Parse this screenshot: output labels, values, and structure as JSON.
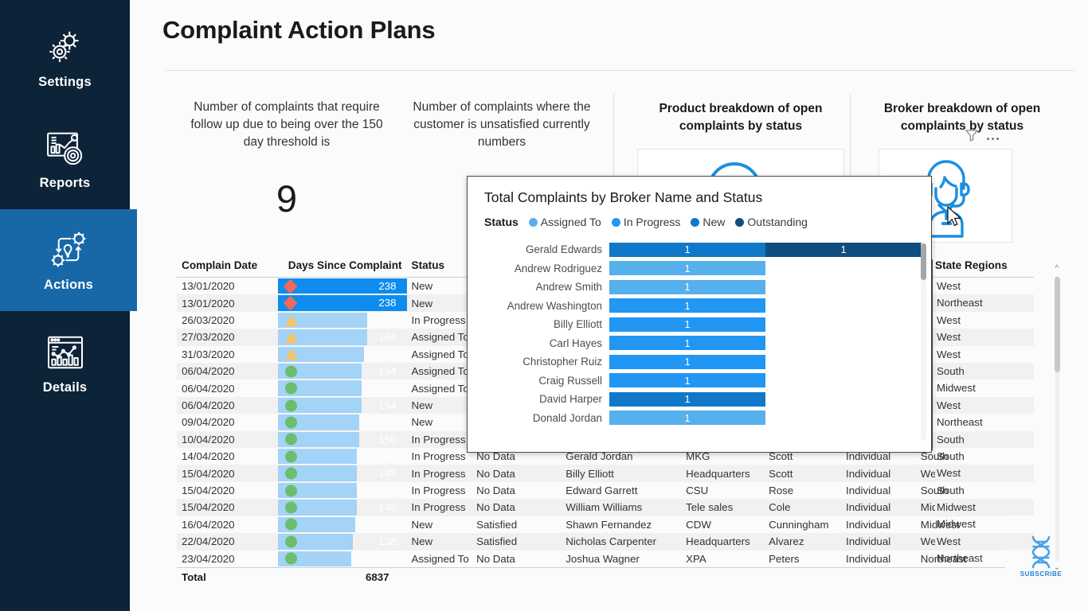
{
  "page": {
    "title": "Complaint Action Plans"
  },
  "sidebar": {
    "items": [
      {
        "label": "Settings",
        "icon": "gears-icon",
        "active": false
      },
      {
        "label": "Reports",
        "icon": "report-chart-icon",
        "active": false
      },
      {
        "label": "Actions",
        "icon": "workflow-idea-icon",
        "active": true
      },
      {
        "label": "Details",
        "icon": "dashboard-bars-icon",
        "active": false
      }
    ]
  },
  "kpis": [
    {
      "caption": "Number of complaints that require follow up due to being over the 150 day threshold is",
      "value": "9"
    },
    {
      "caption": "Number of complaints where the customer is unsatisfied currently numbers",
      "value": ""
    }
  ],
  "visuals": {
    "product": {
      "title": "Product breakdown of open complaints by status",
      "icon": "headset-outline-icon"
    },
    "broker": {
      "title": "Broker breakdown of open complaints by status",
      "icon": "support-agent-icon",
      "filter_icon": "filter-icon",
      "more_icon": "ellipsis-icon"
    }
  },
  "table": {
    "columns": [
      "Complain Date",
      "Days Since Complaint",
      "Status",
      "",
      "",
      "",
      "",
      "",
      ""
    ],
    "rows": [
      {
        "date": "13/01/2020",
        "marker": "diamond",
        "days": 238,
        "bar_pct": 100,
        "bar_tone": "dark",
        "status": "New",
        "satisfaction": "",
        "broker": "",
        "product": "",
        "manager": "",
        "type": "",
        "region": ""
      },
      {
        "date": "13/01/2020",
        "marker": "diamond",
        "days": 238,
        "bar_pct": 100,
        "bar_tone": "dark",
        "status": "New",
        "satisfaction": "",
        "broker": "",
        "product": "",
        "manager": "",
        "type": "",
        "region": ""
      },
      {
        "date": "26/03/2020",
        "marker": "triangle",
        "days": 165,
        "bar_pct": 69,
        "bar_tone": "light",
        "status": "In Progress",
        "satisfaction": "",
        "broker": "",
        "product": "",
        "manager": "",
        "type": "",
        "region": ""
      },
      {
        "date": "27/03/2020",
        "marker": "triangle",
        "days": 164,
        "bar_pct": 69,
        "bar_tone": "light",
        "status": "Assigned To",
        "satisfaction": "",
        "broker": "",
        "product": "",
        "manager": "",
        "type": "",
        "region": ""
      },
      {
        "date": "31/03/2020",
        "marker": "triangle",
        "days": 160,
        "bar_pct": 67,
        "bar_tone": "light",
        "status": "Assigned To",
        "satisfaction": "",
        "broker": "",
        "product": "",
        "manager": "",
        "type": "",
        "region": ""
      },
      {
        "date": "06/04/2020",
        "marker": "circle",
        "days": 154,
        "bar_pct": 65,
        "bar_tone": "light",
        "status": "Assigned To",
        "satisfaction": "",
        "broker": "",
        "product": "",
        "manager": "",
        "type": "",
        "region": ""
      },
      {
        "date": "06/04/2020",
        "marker": "circle",
        "days": 154,
        "bar_pct": 65,
        "bar_tone": "light",
        "status": "Assigned To",
        "satisfaction": "",
        "broker": "",
        "product": "",
        "manager": "",
        "type": "",
        "region": ""
      },
      {
        "date": "06/04/2020",
        "marker": "circle",
        "days": 154,
        "bar_pct": 65,
        "bar_tone": "light",
        "status": "New",
        "satisfaction": "",
        "broker": "",
        "product": "",
        "manager": "",
        "type": "",
        "region": ""
      },
      {
        "date": "09/04/2020",
        "marker": "circle",
        "days": 151,
        "bar_pct": 63,
        "bar_tone": "light",
        "status": "New",
        "satisfaction": "",
        "broker": "",
        "product": "",
        "manager": "",
        "type": "",
        "region": ""
      },
      {
        "date": "10/04/2020",
        "marker": "circle",
        "days": 150,
        "bar_pct": 63,
        "bar_tone": "light",
        "status": "In Progress",
        "satisfaction": "",
        "broker": "",
        "product": "",
        "manager": "",
        "type": "",
        "region": ""
      },
      {
        "date": "14/04/2020",
        "marker": "circle",
        "days": 146,
        "bar_pct": 61,
        "bar_tone": "light",
        "status": "In Progress",
        "satisfaction": "No Data",
        "broker": "Gerald Jordan",
        "product": "MKG",
        "manager": "Scott",
        "type": "Individual",
        "region": "South"
      },
      {
        "date": "15/04/2020",
        "marker": "circle",
        "days": 145,
        "bar_pct": 61,
        "bar_tone": "light",
        "status": "In Progress",
        "satisfaction": "No Data",
        "broker": "Billy Elliott",
        "product": "Headquarters",
        "manager": "Scott",
        "type": "Individual",
        "region": "West"
      },
      {
        "date": "15/04/2020",
        "marker": "circle",
        "days": 145,
        "bar_pct": 61,
        "bar_tone": "light",
        "status": "In Progress",
        "satisfaction": "No Data",
        "broker": "Edward Garrett",
        "product": "CSU",
        "manager": "Rose",
        "type": "Individual",
        "region": "South"
      },
      {
        "date": "15/04/2020",
        "marker": "circle",
        "days": 145,
        "bar_pct": 61,
        "bar_tone": "light",
        "status": "In Progress",
        "satisfaction": "No Data",
        "broker": "William Williams",
        "product": "Tele sales",
        "manager": "Cole",
        "type": "Individual",
        "region": "Midwest"
      },
      {
        "date": "16/04/2020",
        "marker": "circle",
        "days": 144,
        "bar_pct": 60,
        "bar_tone": "light",
        "status": "New",
        "satisfaction": "Satisfied",
        "broker": "Shawn Fernandez",
        "product": "CDW",
        "manager": "Cunningham",
        "type": "Individual",
        "region": "Midwest"
      },
      {
        "date": "22/04/2020",
        "marker": "circle",
        "days": 138,
        "bar_pct": 58,
        "bar_tone": "light",
        "status": "New",
        "satisfaction": "Satisfied",
        "broker": "Nicholas Carpenter",
        "product": "Headquarters",
        "manager": "Alvarez",
        "type": "Individual",
        "region": "West"
      },
      {
        "date": "23/04/2020",
        "marker": "circle",
        "days": 137,
        "bar_pct": 57,
        "bar_tone": "light",
        "status": "Assigned To",
        "satisfaction": "No Data",
        "broker": "Joshua Wagner",
        "product": "XPA",
        "manager": "Peters",
        "type": "Individual",
        "region": "Northeast"
      }
    ],
    "total_label": "Total",
    "total_value": "6837"
  },
  "slicer": {
    "title": "State Regions",
    "items": [
      "West",
      "Northeast",
      "West",
      "West",
      "West",
      "South",
      "Midwest",
      "West",
      "Northeast",
      "South",
      "South",
      "West",
      "South",
      "Midwest",
      "Midwest",
      "West",
      "Northeast"
    ],
    "scroll_up_icon": "chevron-up-icon",
    "scroll_down_icon": "chevron-down-icon"
  },
  "tooltip": {
    "title": "Total Complaints by Broker Name and Status",
    "legend_label": "Status"
  },
  "colors": {
    "sidebar_bg": "#0d2338",
    "accent": "#1868a8",
    "assigned_to": "#56b0ec",
    "in_progress": "#2196f3",
    "new": "#1078c8",
    "outstanding": "#0f4e80",
    "databar_dark": "#0e8cf0",
    "databar_light": "#a3d3f7",
    "marker_red": "#ef6a5a",
    "marker_amber": "#f6c561",
    "marker_green": "#6cbd6c"
  },
  "chart_data": {
    "type": "bar",
    "title": "Total Complaints by Broker Name and Status",
    "orientation": "horizontal",
    "stacked": true,
    "legend_title": "Status",
    "legend_position": "top",
    "grid": false,
    "xlabel": "",
    "ylabel": "",
    "xlim": [
      0,
      2
    ],
    "categories": [
      "Gerald Edwards",
      "Andrew Rodriguez",
      "Andrew Smith",
      "Andrew Washington",
      "Billy Elliott",
      "Carl Hayes",
      "Christopher Ruiz",
      "Craig Russell",
      "David Harper",
      "Donald Jordan"
    ],
    "series": [
      {
        "name": "Assigned To",
        "color": "#56b0ec",
        "values": [
          0,
          1,
          1,
          0,
          0,
          0,
          0,
          0,
          0,
          1
        ]
      },
      {
        "name": "In Progress",
        "color": "#2196f3",
        "values": [
          0,
          0,
          0,
          1,
          1,
          1,
          1,
          1,
          0,
          0
        ]
      },
      {
        "name": "New",
        "color": "#1078c8",
        "values": [
          1,
          0,
          0,
          0,
          0,
          0,
          0,
          0,
          1,
          0
        ]
      },
      {
        "name": "Outstanding",
        "color": "#0f4e80",
        "values": [
          1,
          0,
          0,
          0,
          0,
          0,
          0,
          0,
          0,
          0
        ]
      }
    ],
    "data_labels": [
      [
        {
          "series": "New",
          "value": 1
        },
        {
          "series": "Outstanding",
          "value": 1
        }
      ],
      [
        {
          "series": "Assigned To",
          "value": 1
        }
      ],
      [
        {
          "series": "Assigned To",
          "value": 1
        }
      ],
      [
        {
          "series": "In Progress",
          "value": 1
        }
      ],
      [
        {
          "series": "In Progress",
          "value": 1
        }
      ],
      [
        {
          "series": "In Progress",
          "value": 1
        }
      ],
      [
        {
          "series": "In Progress",
          "value": 1
        }
      ],
      [
        {
          "series": "In Progress",
          "value": 1
        }
      ],
      [
        {
          "series": "New",
          "value": 1
        }
      ],
      [
        {
          "series": "Assigned To",
          "value": 1
        }
      ]
    ]
  },
  "watermark": {
    "text": "SUBSCRIBE",
    "icon": "dna-helix-icon"
  }
}
